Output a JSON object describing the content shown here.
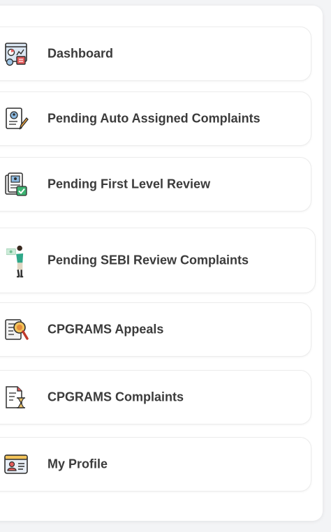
{
  "menu": {
    "items": [
      {
        "label": "Dashboard",
        "icon": "dashboard-icon"
      },
      {
        "label": "Pending Auto Assigned Complaints",
        "icon": "assign-edit-icon"
      },
      {
        "label": "Pending First Level Review",
        "icon": "review-document-icon"
      },
      {
        "label": "Pending SEBI Review Complaints",
        "icon": "person-review-icon"
      },
      {
        "label": "CPGRAMS Appeals",
        "icon": "appeal-search-icon"
      },
      {
        "label": "CPGRAMS Complaints",
        "icon": "hourglass-document-icon"
      },
      {
        "label": "My Profile",
        "icon": "profile-card-icon"
      }
    ]
  }
}
